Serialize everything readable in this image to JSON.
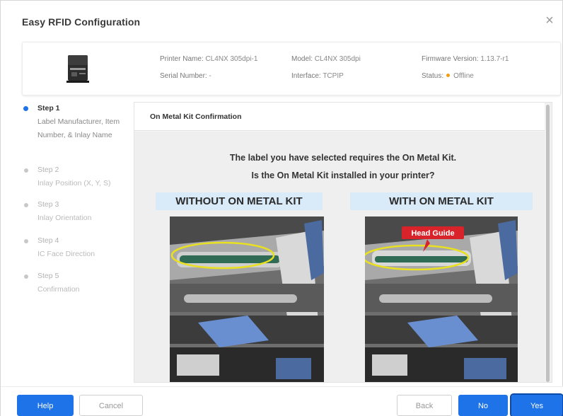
{
  "dialog": {
    "title": "Easy RFID Configuration",
    "close_glyph": "×"
  },
  "printer": {
    "icon": "printer-icon",
    "name_label": "Printer Name:",
    "name_value": "CL4NX 305dpi-1",
    "model_label": "Model:",
    "model_value": "CL4NX 305dpi",
    "firmware_label": "Firmware Version:",
    "firmware_value": "1.13.7-r1",
    "serial_label": "Serial Number:",
    "serial_value": "-",
    "interface_label": "Interface:",
    "interface_value": "TCPIP",
    "status_label": "Status:",
    "status_value": "Offline",
    "status_color": "#f39c12"
  },
  "steps": [
    {
      "number": "Step 1",
      "desc": "Label Manufacturer, Item Number, & Inlay Name",
      "active": true
    },
    {
      "number": "Step 2",
      "desc": "Inlay Position (X, Y, S)",
      "active": false
    },
    {
      "number": "Step 3",
      "desc": "Inlay Orientation",
      "active": false
    },
    {
      "number": "Step 4",
      "desc": "IC Face Direction",
      "active": false
    },
    {
      "number": "Step 5",
      "desc": "Confirmation",
      "active": false
    }
  ],
  "content": {
    "title": "On Metal Kit Confirmation",
    "message_line1": "The label you have selected requires the On Metal Kit.",
    "message_line2": "Is the On Metal Kit installed in your printer?",
    "left_heading": "WITHOUT ON METAL KIT",
    "right_heading": "WITH ON METAL KIT",
    "right_callout": "Head Guide"
  },
  "footer": {
    "help": "Help",
    "cancel": "Cancel",
    "back": "Back",
    "no": "No",
    "yes": "Yes"
  },
  "colors": {
    "accent": "#1e73e8",
    "banner": "#d9eaf8",
    "highlight_ellipse": "#e8e020",
    "callout": "#d9232a"
  }
}
